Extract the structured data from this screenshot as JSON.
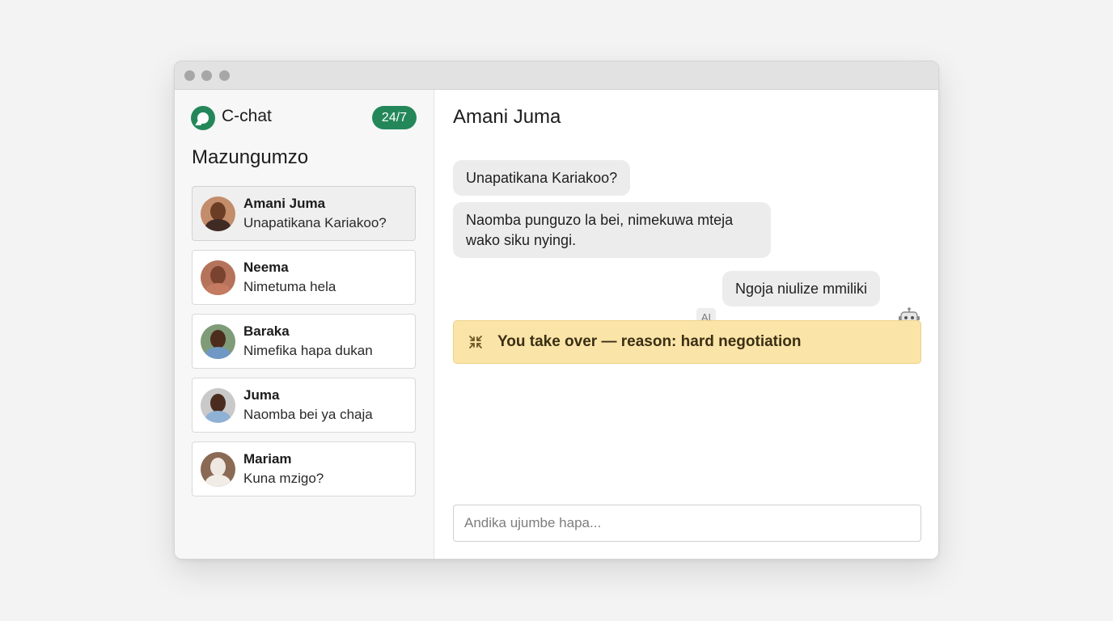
{
  "app": {
    "name": "C-chat",
    "badge": "24/7"
  },
  "sidebar": {
    "title": "Mazungumzo",
    "conversations": [
      {
        "name": "Amani Juma",
        "preview": "Unapatikana Kariakoo?",
        "active": true
      },
      {
        "name": "Neema",
        "preview": "Nimetuma hela",
        "active": false
      },
      {
        "name": "Baraka",
        "preview": "Nimefika hapa dukan",
        "active": false
      },
      {
        "name": "Juma",
        "preview": "Naomba bei ya chaja",
        "active": false
      },
      {
        "name": "Mariam",
        "preview": "Kuna mzigo?",
        "active": false
      }
    ]
  },
  "chat": {
    "title": "Amani Juma",
    "messages": [
      {
        "from": "customer",
        "text": "Unapatikana Kariakoo?"
      },
      {
        "from": "customer",
        "text": "Naomba punguzo la bei, nimekuwa mteja wako siku nyingi."
      },
      {
        "from": "ai",
        "tag": "AI",
        "text": "Ngoja niulize mmiliki"
      }
    ],
    "alert": "You take over — reason: hard negotiation",
    "composer_placeholder": "Andika ujumbe hapa..."
  },
  "icons": {
    "brand": "chat-bubble-icon",
    "bot": "robot-icon",
    "alert": "collapse-arrows-icon"
  },
  "colors": {
    "brand_green": "#24875a",
    "alert_bg": "#fbe4a8",
    "bubble_bg": "#ececec"
  }
}
